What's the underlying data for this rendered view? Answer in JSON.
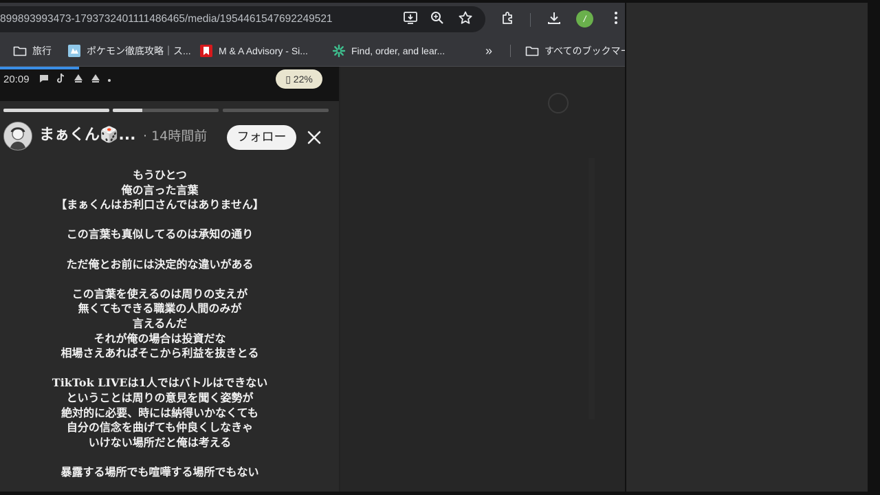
{
  "toolbar": {
    "url": "899893993473-1793732401111486465/media/1954461547692249521",
    "profile_initial": "/",
    "icons": [
      "install-icon",
      "zoom-icon",
      "star-icon",
      "extensions-icon",
      "download-icon",
      "menu-icon"
    ]
  },
  "bookmarks": {
    "items": [
      {
        "label": "旅行",
        "icon": "folder-icon"
      },
      {
        "label": "ポケモン徹底攻略｜ス...",
        "icon": "site-favicon-pokemon"
      },
      {
        "label": "M & A Advisory - Si...",
        "icon": "site-favicon-red"
      },
      {
        "label": "Find, order, and lear...",
        "icon": "site-favicon-green"
      }
    ],
    "overflow": "»",
    "all_label": "すべてのブックマーク"
  },
  "story": {
    "time": "20:09",
    "battery": "22%",
    "progress": [
      1.0,
      0.28,
      0.0
    ],
    "username": "まぁくん🎲...",
    "posted": "· 14時間前",
    "follow_label": "フォロー",
    "lines": [
      "もうひとつ",
      "俺の言った言葉",
      "【まぁくんはお利口さんではありません】",
      "",
      "この言葉も真似してるのは承知の通り",
      "",
      "ただ俺とお前には決定的な違いがある",
      "",
      "この言葉を使えるのは周りの支えが",
      "無くてもできる職業の人間のみが",
      "言えるんだ",
      "それが俺の場合は投資だな",
      "相場さえあればそこから利益を抜きとる",
      "",
      "TikTok LIVEは1人ではバトルはできない",
      "ということは周りの意見を聞く姿勢が",
      "絶対的に必要、時には納得いかなくても",
      "自分の信念を曲げても仲良くしなきゃ",
      "いけない場所だと俺は考える",
      "",
      "暴露する場所でも喧嘩する場所でもない"
    ]
  }
}
